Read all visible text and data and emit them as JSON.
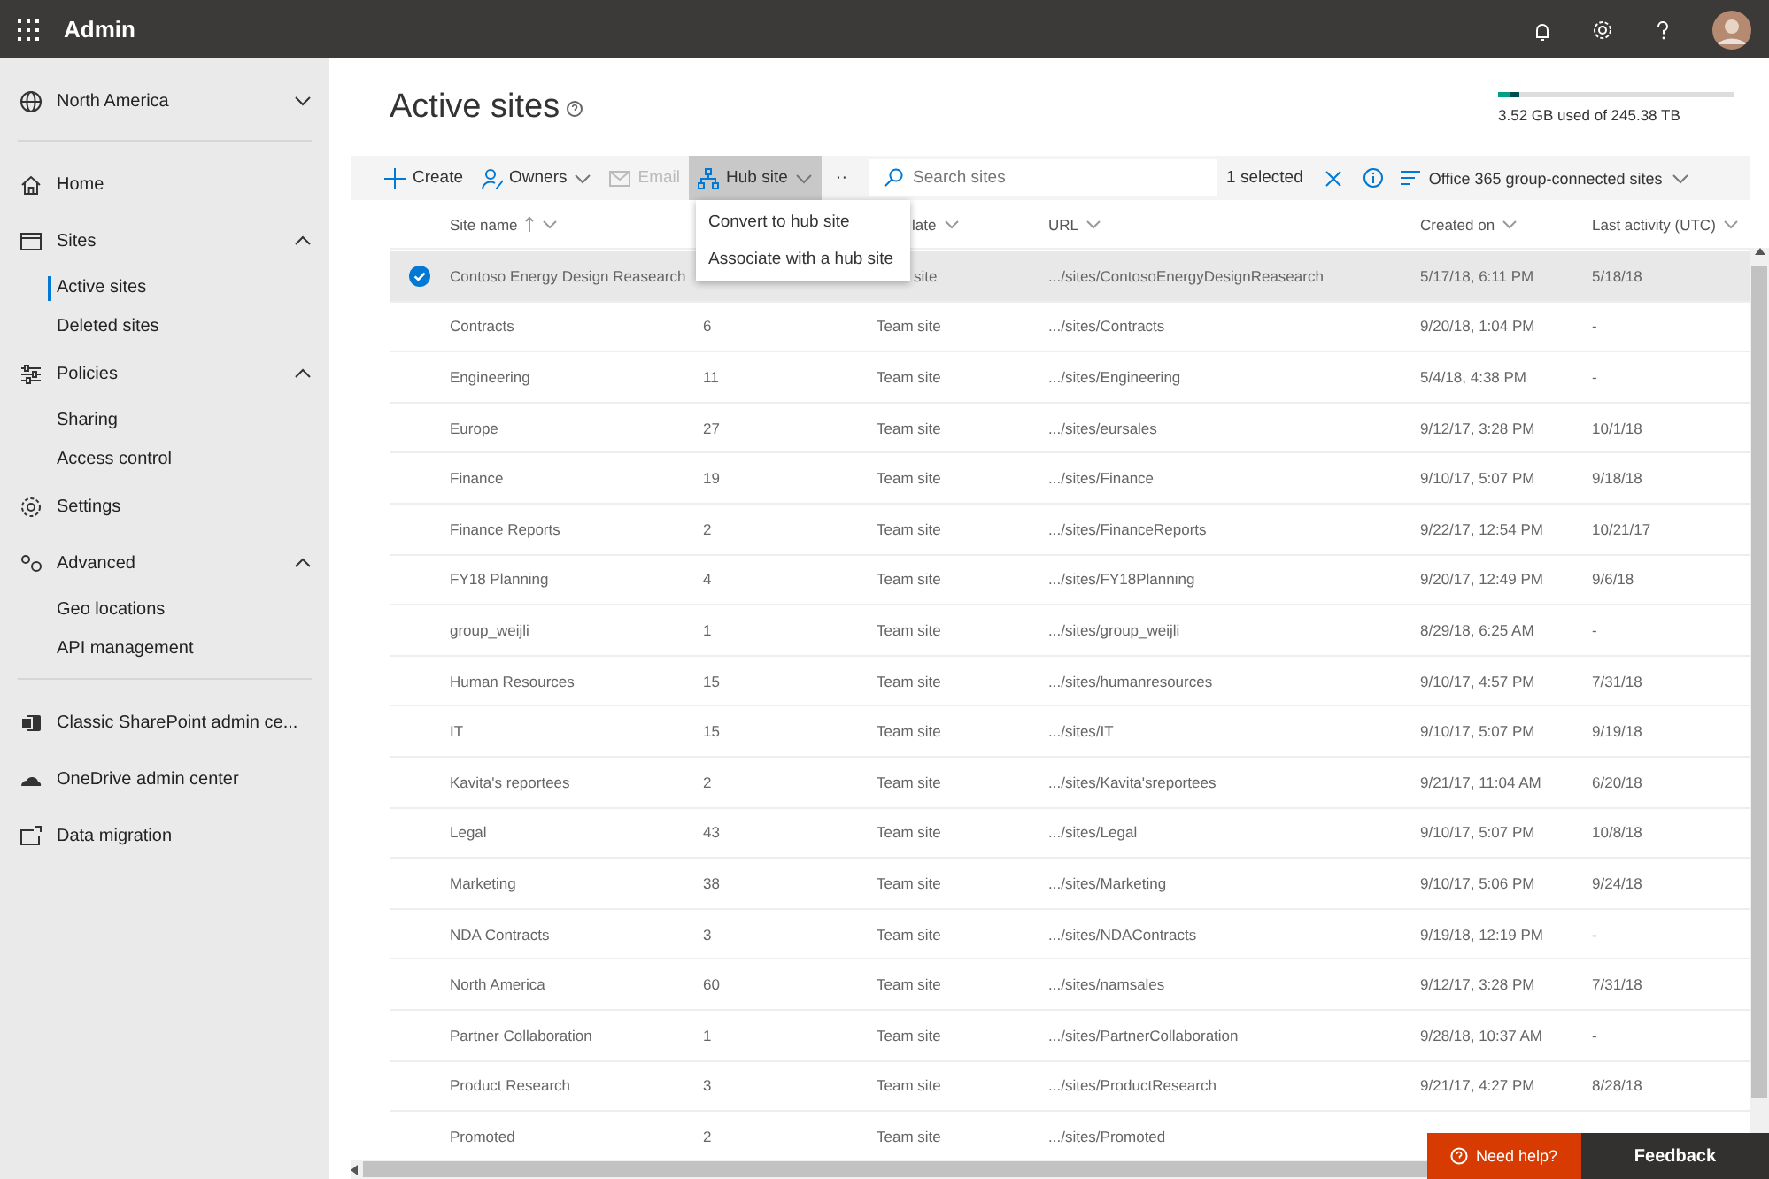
{
  "top_bar": {
    "app_title": "Admin"
  },
  "sidebar": {
    "groups": [
      [
        {
          "label": "North America",
          "expanded": false
        }
      ],
      [
        {
          "label": "Home"
        },
        {
          "label": "Sites",
          "expanded": true,
          "children": [
            {
              "label": "Active sites",
              "selected": true
            },
            {
              "label": "Deleted sites",
              "selected": false
            }
          ]
        },
        {
          "label": "Policies",
          "expanded": true,
          "children": [
            {
              "label": "Sharing",
              "selected": false
            },
            {
              "label": "Access control",
              "selected": false
            }
          ]
        },
        {
          "label": "Settings"
        },
        {
          "label": "Advanced",
          "expanded": true,
          "children": [
            {
              "label": "Geo locations",
              "selected": false
            },
            {
              "label": "API management",
              "selected": false
            }
          ]
        }
      ],
      [
        {
          "label": "Classic SharePoint admin ce..."
        },
        {
          "label": "OneDrive admin center"
        },
        {
          "label": "Data migration"
        }
      ]
    ]
  },
  "page": {
    "title": "Active sites",
    "storage": {
      "level": 0.09,
      "text": "3.52 GB used of 245.38 TB"
    }
  },
  "toolbar": {
    "commands": [
      {
        "label": "Create",
        "disabled": false,
        "has_menu": false,
        "expanded": false
      },
      {
        "label": "Owners",
        "disabled": false,
        "has_menu": true,
        "expanded": false
      },
      {
        "label": "Email",
        "disabled": true,
        "has_menu": false,
        "expanded": false
      },
      {
        "label": "Hub site",
        "disabled": false,
        "has_menu": true,
        "expanded": true
      }
    ],
    "more": "··",
    "search": {
      "placeholder": "Search sites"
    },
    "selection": "1 selected",
    "view": "Office 365 group-connected sites"
  },
  "hub_menu": [
    "Convert to hub site",
    "Associate with a hub site"
  ],
  "table": {
    "columns": [
      {
        "label": "Site name",
        "sorted": true
      },
      {
        "label": "late",
        "sorted": false
      },
      {
        "label": "URL",
        "sorted": false
      },
      {
        "label": "Created on",
        "sorted": false
      },
      {
        "label": "Last activity (UTC)",
        "sorted": false
      }
    ],
    "rows": [
      {
        "selected": true,
        "site_name": "Contoso Energy Design Reasearch",
        "template": "site",
        "url": ".../sites/ContosoEnergyDesignReasearch",
        "created_on": "5/17/18, 6:11 PM",
        "last_activity": "5/18/18"
      },
      {
        "selected": false,
        "site_name": "Contracts",
        "column_2": "6",
        "template": "Team site",
        "url": ".../sites/Contracts",
        "created_on": "9/20/18, 1:04 PM",
        "last_activity": "-"
      },
      {
        "selected": false,
        "site_name": "Engineering",
        "column_2": "11",
        "template": "Team site",
        "url": ".../sites/Engineering",
        "created_on": "5/4/18, 4:38 PM",
        "last_activity": "-"
      },
      {
        "selected": false,
        "site_name": "Europe",
        "column_2": "27",
        "template": "Team site",
        "url": ".../sites/eursales",
        "created_on": "9/12/17, 3:28 PM",
        "last_activity": "10/1/18"
      },
      {
        "selected": false,
        "site_name": "Finance",
        "column_2": "19",
        "template": "Team site",
        "url": ".../sites/Finance",
        "created_on": "9/10/17, 5:07 PM",
        "last_activity": "9/18/18"
      },
      {
        "selected": false,
        "site_name": "Finance Reports",
        "column_2": "2",
        "template": "Team site",
        "url": ".../sites/FinanceReports",
        "created_on": "9/22/17, 12:54 PM",
        "last_activity": "10/21/17"
      },
      {
        "selected": false,
        "site_name": "FY18 Planning",
        "column_2": "4",
        "template": "Team site",
        "url": ".../sites/FY18Planning",
        "created_on": "9/20/17, 12:49 PM",
        "last_activity": "9/6/18"
      },
      {
        "selected": false,
        "site_name": "group_weijli",
        "column_2": "1",
        "template": "Team site",
        "url": ".../sites/group_weijli",
        "created_on": "8/29/18, 6:25 AM",
        "last_activity": "-"
      },
      {
        "selected": false,
        "site_name": "Human Resources",
        "column_2": "15",
        "template": "Team site",
        "url": ".../sites/humanresources",
        "created_on": "9/10/17, 4:57 PM",
        "last_activity": "7/31/18"
      },
      {
        "selected": false,
        "site_name": "IT",
        "column_2": "15",
        "template": "Team site",
        "url": ".../sites/IT",
        "created_on": "9/10/17, 5:07 PM",
        "last_activity": "9/19/18"
      },
      {
        "selected": false,
        "site_name": "Kavita's reportees",
        "column_2": "2",
        "template": "Team site",
        "url": ".../sites/Kavita'sreportees",
        "created_on": "9/21/17, 11:04 AM",
        "last_activity": "6/20/18"
      },
      {
        "selected": false,
        "site_name": "Legal",
        "column_2": "43",
        "template": "Team site",
        "url": ".../sites/Legal",
        "created_on": "9/10/17, 5:07 PM",
        "last_activity": "10/8/18"
      },
      {
        "selected": false,
        "site_name": "Marketing",
        "column_2": "38",
        "template": "Team site",
        "url": ".../sites/Marketing",
        "created_on": "9/10/17, 5:06 PM",
        "last_activity": "9/24/18"
      },
      {
        "selected": false,
        "site_name": "NDA Contracts",
        "column_2": "3",
        "template": "Team site",
        "url": ".../sites/NDAContracts",
        "created_on": "9/19/18, 12:19 PM",
        "last_activity": "-"
      },
      {
        "selected": false,
        "site_name": "North America",
        "column_2": "60",
        "template": "Team site",
        "url": ".../sites/namsales",
        "created_on": "9/12/17, 3:28 PM",
        "last_activity": "7/31/18"
      },
      {
        "selected": false,
        "site_name": "Partner Collaboration",
        "column_2": "1",
        "template": "Team site",
        "url": ".../sites/PartnerCollaboration",
        "created_on": "9/28/18, 10:37 AM",
        "last_activity": "-"
      },
      {
        "selected": false,
        "site_name": "Product Research",
        "column_2": "3",
        "template": "Team site",
        "url": ".../sites/ProductResearch",
        "created_on": "9/21/17, 4:27 PM",
        "last_activity": "8/28/18"
      },
      {
        "selected": false,
        "site_name": "Promoted",
        "column_2": "2",
        "template": "Team site",
        "url": ".../sites/Promoted"
      }
    ]
  },
  "help": {
    "need_help": "Need help?",
    "feedback": "Feedback"
  }
}
